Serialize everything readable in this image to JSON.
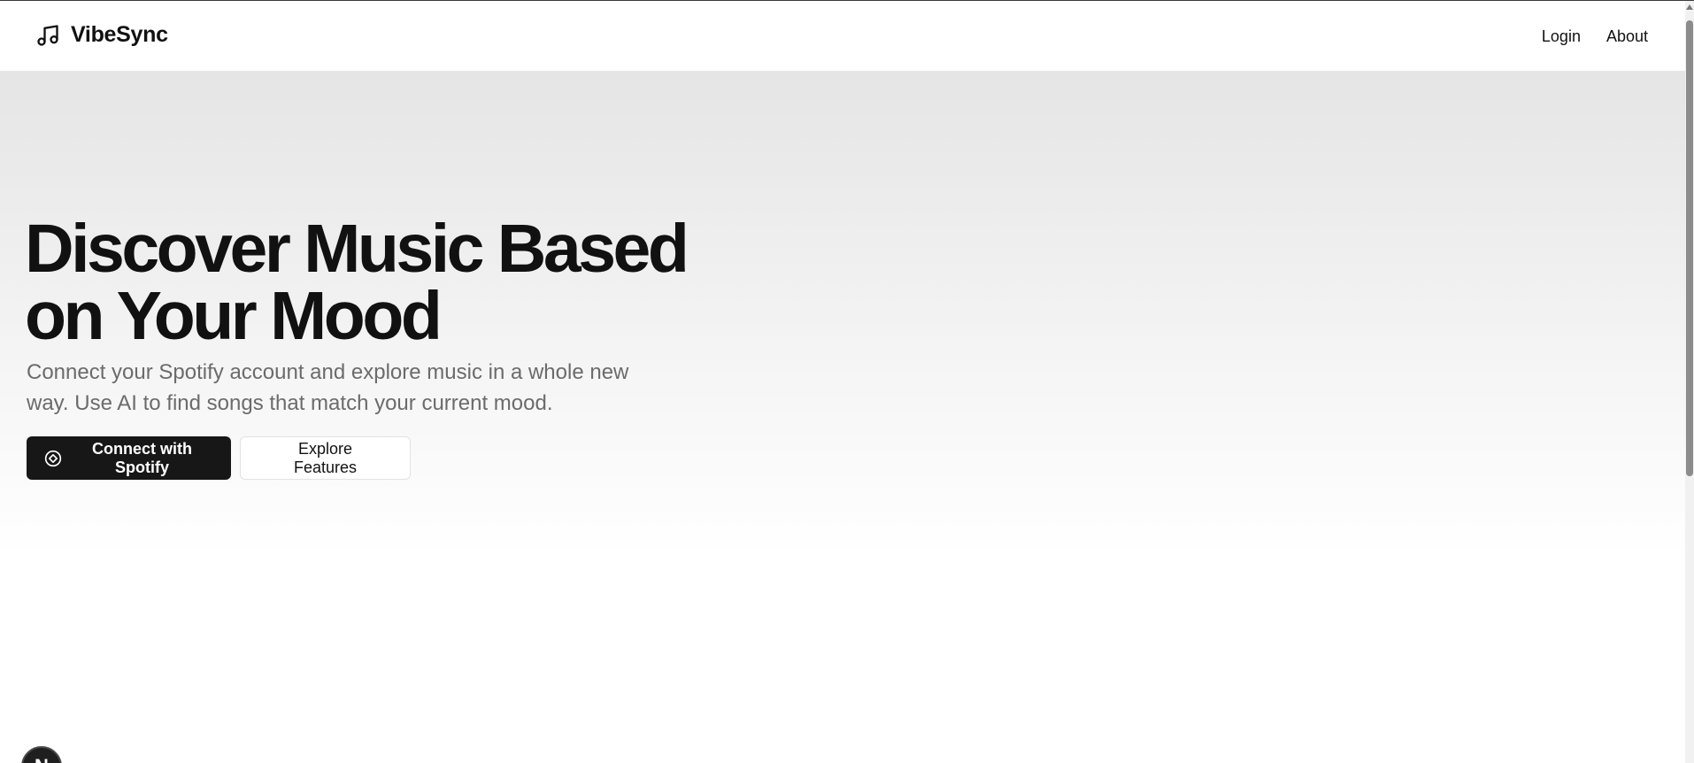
{
  "header": {
    "brand_name": "VibeSync",
    "logo_icon": "music-note-icon",
    "nav": [
      {
        "label": "Login"
      },
      {
        "label": "About"
      }
    ]
  },
  "hero": {
    "headline": "Discover Music Based on Your Mood",
    "subtitle": "Connect your Spotify account and explore music in a whole new way. Use AI to find songs that match your current mood.",
    "primary_button": {
      "label": "Connect with Spotify",
      "icon": "spotify-disc-icon"
    },
    "secondary_button": {
      "label": "Explore Features"
    }
  },
  "dev_badge": {
    "label": "N"
  },
  "colors": {
    "primary_button_bg": "#171717",
    "subtitle_text": "#6b6b6b",
    "hero_gradient_top": "#e5e5e5",
    "hero_gradient_bottom": "#ffffff"
  }
}
